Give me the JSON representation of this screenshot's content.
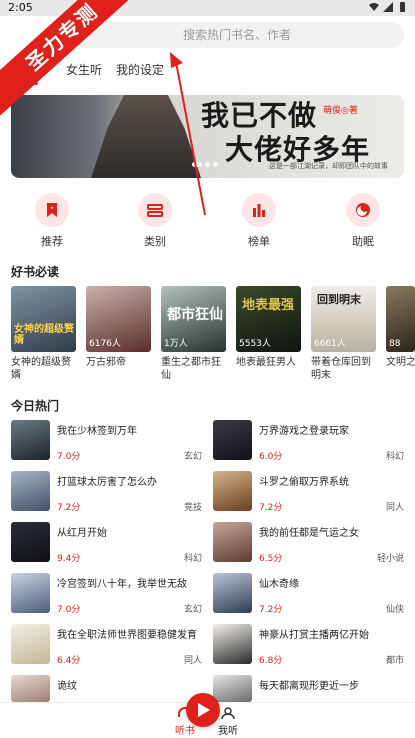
{
  "status_bar": {
    "time": "2:05"
  },
  "watermark": "圣力专测",
  "search": {
    "placeholder": "搜索热门书名、作者"
  },
  "tabs": [
    {
      "label": "听",
      "active": true
    },
    {
      "label": "女生听",
      "active": false
    },
    {
      "label": "我的设定",
      "active": false
    }
  ],
  "banner": {
    "title_line1": "我已不做",
    "title_line2": "大佬好多年",
    "author": "萌俊◎著",
    "subtitle": "这是一部江湖记录，却即团队中的故事"
  },
  "quick_entries": [
    {
      "label": "推荐",
      "icon": "bookmark-icon"
    },
    {
      "label": "类别",
      "icon": "category-icon"
    },
    {
      "label": "榜单",
      "icon": "ranking-icon"
    },
    {
      "label": "助眠",
      "icon": "sleep-icon"
    }
  ],
  "featured": {
    "title": "好书必读",
    "books": [
      {
        "name": "女神的超级赘婿",
        "count": "",
        "cover_text": "女神的超级赘婿"
      },
      {
        "name": "万古邪帝",
        "count": "6176人",
        "cover_text": ""
      },
      {
        "name": "重生之都市狂仙",
        "count": "1万人",
        "cover_text": "都市狂仙"
      },
      {
        "name": "地表最狂男人",
        "count": "5553人",
        "cover_text": "地表最强"
      },
      {
        "name": "带着仓库回到明末",
        "count": "6661人",
        "cover_text": "回到明末"
      },
      {
        "name": "文明之",
        "count": "88",
        "cover_text": ""
      }
    ]
  },
  "hot_today": {
    "title": "今日热门",
    "items": [
      {
        "title": "我在少林签到万年",
        "score": "7.0分",
        "genre": "玄幻"
      },
      {
        "title": "万界游戏之登录玩家",
        "score": "6.0分",
        "genre": "科幻"
      },
      {
        "title": "打篮球太厉害了怎么办",
        "score": "7.2分",
        "genre": "竞技"
      },
      {
        "title": "斗罗之偷取万界系统",
        "score": "7.2分",
        "genre": "同人"
      },
      {
        "title": "从红月开始",
        "score": "9.4分",
        "genre": "科幻"
      },
      {
        "title": "我的前任都是气运之女",
        "score": "6.5分",
        "genre": "轻小说"
      },
      {
        "title": "冷宫签到八十年，我举世无敌",
        "score": "7.0分",
        "genre": "玄幻"
      },
      {
        "title": "仙木奇缘",
        "score": "7.2分",
        "genre": "仙侠"
      },
      {
        "title": "我在全职法师世界图要稳健发育",
        "score": "6.4分",
        "genre": "同人"
      },
      {
        "title": "神豪从打赏主播两亿开始",
        "score": "6.8分",
        "genre": "都市"
      },
      {
        "title": "诡纹",
        "score": "",
        "genre": ""
      },
      {
        "title": "每天都离现形更近一步",
        "score": "",
        "genre": ""
      }
    ]
  },
  "bottom_nav": [
    {
      "label": "听书",
      "active": true
    },
    {
      "label": "我听",
      "active": false
    }
  ],
  "colors": {
    "accent": "#e0201a",
    "accent_soft": "#fde6e4"
  }
}
